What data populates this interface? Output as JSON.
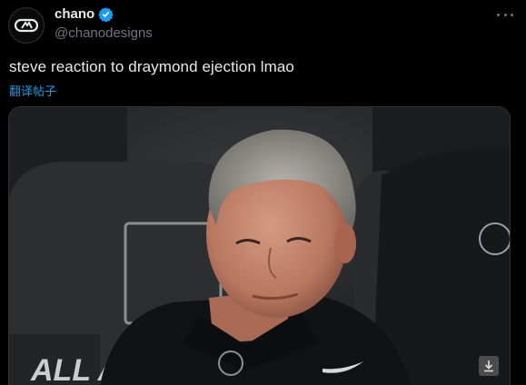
{
  "author": {
    "display_name": "chano",
    "handle": "@chanodesigns",
    "verified": true,
    "avatar_icon": "chano-logo-icon"
  },
  "post": {
    "text": "steve reaction to draymond ejection lmao",
    "translate_label": "翻译帖子"
  },
  "media": {
    "type": "image",
    "banner_text": "ALL AC",
    "download_icon": "download-icon"
  },
  "colors": {
    "background": "#000000",
    "text_primary": "#e7e9ea",
    "text_secondary": "#71767b",
    "link": "#1d9bf0",
    "verified_badge": "#1d9bf0"
  }
}
